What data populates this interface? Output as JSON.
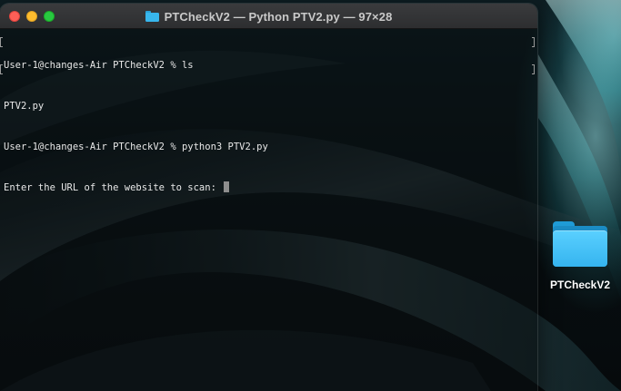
{
  "window": {
    "title": "PTCheckV2 — Python PTV2.py — 97×28",
    "title_icon": "folder-icon",
    "buttons": [
      "close",
      "minimize",
      "zoom"
    ]
  },
  "terminal": {
    "lines": [
      "User-1@changes-Air PTCheckV2 % ls",
      "PTV2.py",
      "User-1@changes-Air PTCheckV2 % python3 PTV2.py",
      "Enter the URL of the website to scan: "
    ],
    "cursor_visible": true,
    "text_color": "#e8e8e8"
  },
  "desktop": {
    "icons": [
      {
        "label": "PTCheckV2",
        "icon": "folder-icon"
      }
    ],
    "accent_colors": {
      "folder": "#38b6ec",
      "wallpaper_glow": "#8fe3e8"
    }
  }
}
